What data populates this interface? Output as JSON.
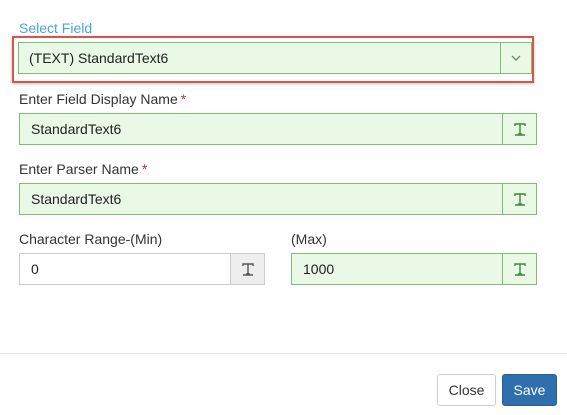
{
  "select_field": {
    "label": "Select Field",
    "value": "(TEXT) StandardText6",
    "caret_icon": "chevron-down-icon"
  },
  "display_name": {
    "label": "Enter Field Display Name",
    "required_marker": "*",
    "value": "StandardText6",
    "icon": "text-type-icon"
  },
  "parser_name": {
    "label": "Enter Parser Name",
    "required_marker": "*",
    "value": "StandardText6",
    "icon": "text-type-icon"
  },
  "char_range_min": {
    "label": "Character Range-(Min)",
    "value": "0",
    "icon": "text-type-icon"
  },
  "char_range_max": {
    "label": "(Max)",
    "value": "1000",
    "icon": "text-type-icon"
  },
  "footer": {
    "close_label": "Close",
    "save_label": "Save"
  },
  "colors": {
    "valid_fill": "#e9f9e5",
    "valid_border": "#7bbf72",
    "select_label": "#4aa3df",
    "highlight_border": "#d9534f",
    "required": "#c9302c",
    "save_button": "#2f6fae"
  }
}
